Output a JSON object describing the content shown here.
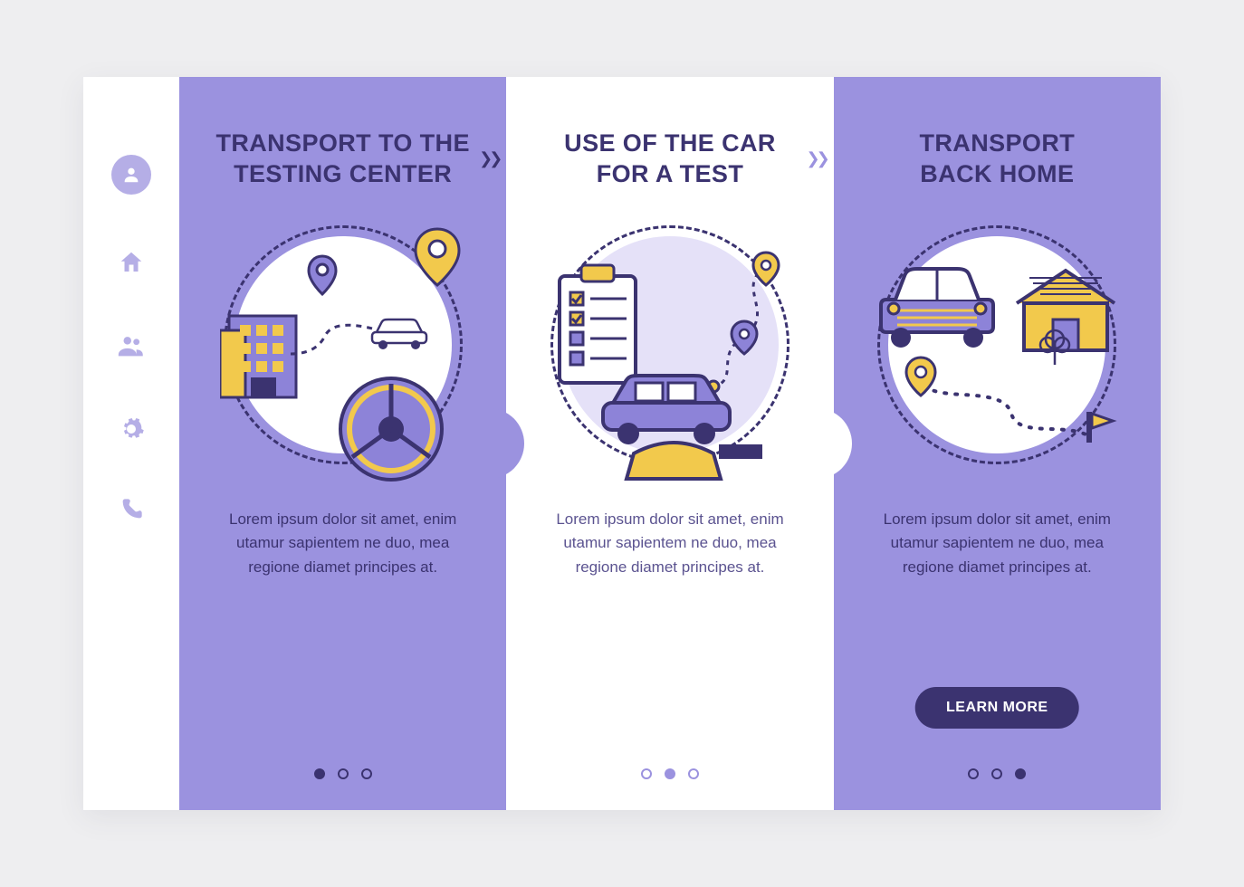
{
  "sidebar": {
    "icons": [
      "profile-icon",
      "home-icon",
      "group-icon",
      "settings-icon",
      "phone-icon"
    ]
  },
  "panels": [
    {
      "title": "TRANSPORT TO THE\nTESTING CENTER",
      "body": "Lorem ipsum dolor sit amet, enim utamur sapientem ne duo, mea regione diamet principes at.",
      "activeDot": 0,
      "cta": null
    },
    {
      "title": "USE OF THE CAR\nFOR A TEST",
      "body": "Lorem ipsum dolor sit amet, enim utamur sapientem ne duo, mea regione diamet principes at.",
      "activeDot": 1,
      "cta": null
    },
    {
      "title": "TRANSPORT\nBACK HOME",
      "body": "Lorem ipsum dolor sit amet, enim utamur sapientem ne duo, mea regione diamet principes at.",
      "activeDot": 2,
      "cta": "LEARN MORE"
    }
  ]
}
